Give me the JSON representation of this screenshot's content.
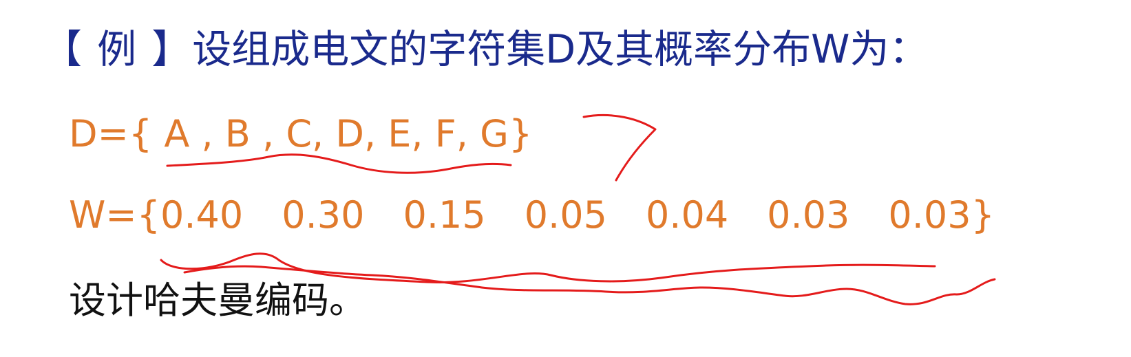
{
  "title": {
    "bracket_open": "【 ",
    "example": "例",
    "bracket_close": " 】",
    "text": "设组成电文的字符集D及其概率分布W为："
  },
  "charset": {
    "text": "D={ A , B , C, D, E, F, G}"
  },
  "weights": {
    "prefix": "W={",
    "values": [
      "0.40",
      "0.30",
      "0.15",
      "0.05",
      "0.04",
      "0.03",
      "0.03"
    ],
    "suffix": "}"
  },
  "task": {
    "text": "设计哈夫曼编码。"
  },
  "colors": {
    "title": "#1a2a8c",
    "formula": "#e07a2c",
    "body": "#111111",
    "annotation": "#e41b1b"
  }
}
